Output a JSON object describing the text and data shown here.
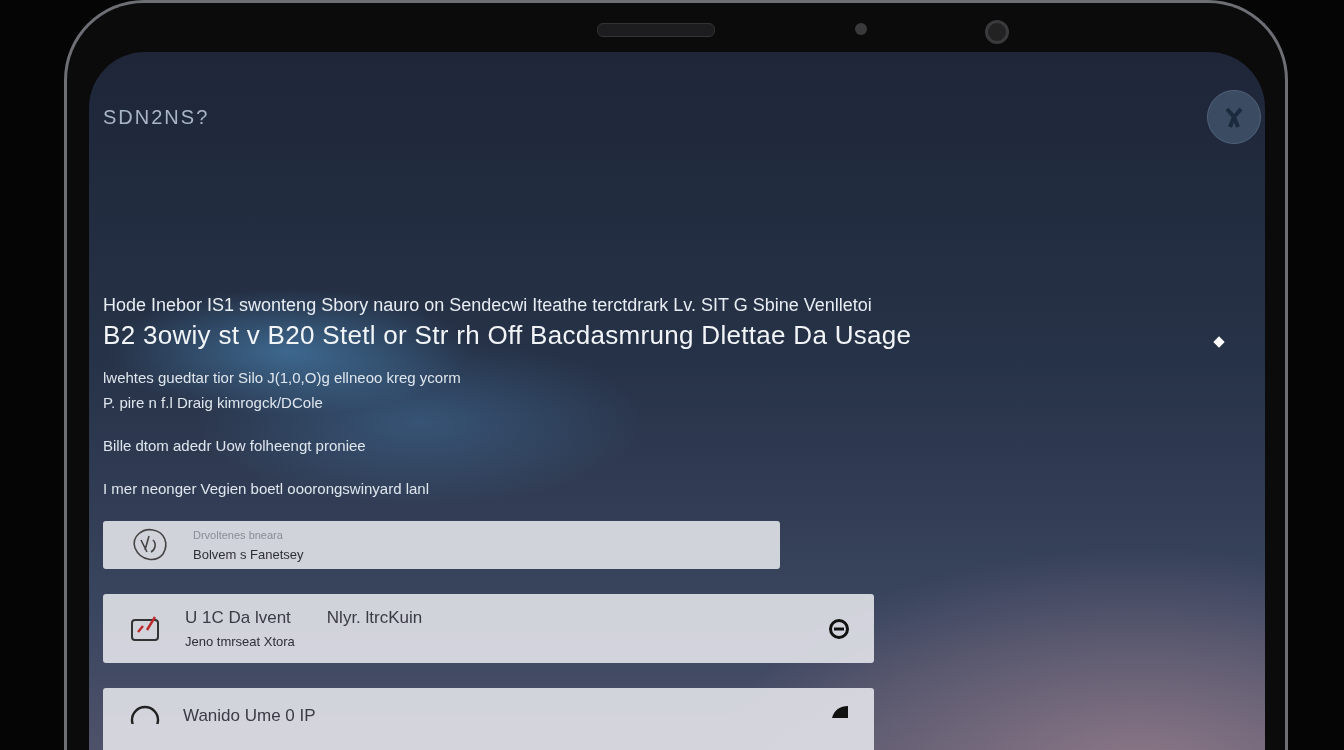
{
  "app": {
    "title": "SDN2NS?"
  },
  "headline": {
    "kicker": "Hode Inebor IS1 swonteng Sbory nauro on Sendecwi Iteathe terctdrark Lv. SIT G Sbine Venlletoi",
    "title": "B2 3owiy st v B20 Stetl or Str rh Off Bacdasmrung Dlettae Da Usage"
  },
  "paragraphs": [
    "lwehtes guedtar tior Silo J(1,0,O)g ellneoo kreg ycorm",
    "P. pire n f.l Draig kimrogck/DCole",
    "Bille dtom adedr Uow folheengt proniee",
    "I mer neonger Vegien boetl ooorongswinyard lanl"
  ],
  "cards": [
    {
      "kind": "info",
      "caption": "Drvoltenes bneara",
      "subtitle": "Bolvem s Fanetsey"
    },
    {
      "kind": "toggle",
      "title": "U 1C Da lvent",
      "detail": "Nlyr. ltrcKuin",
      "subtitle": "Jeno tmrseat Xtora"
    },
    {
      "kind": "partial",
      "title": "Wanido Ume 0 IP"
    }
  ]
}
